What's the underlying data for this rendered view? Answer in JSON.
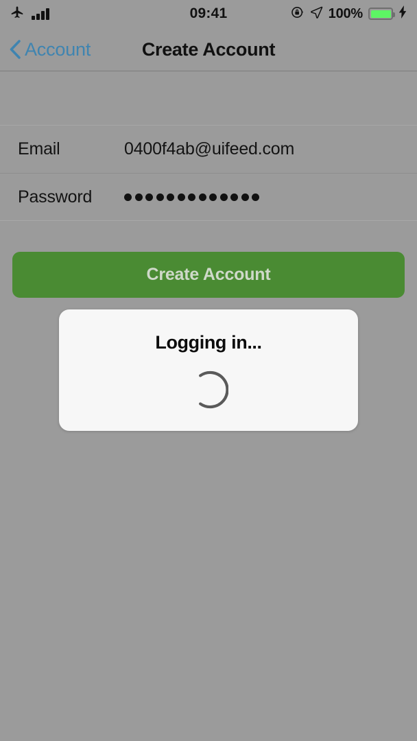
{
  "status_bar": {
    "airplane_icon": "airplane-mode-icon",
    "signal_icon": "signal-bars-icon",
    "time": "09:41",
    "rotation_lock_icon": "rotation-lock-icon",
    "location_icon": "location-arrow-icon",
    "battery_percent": "100%",
    "battery_icon": "battery-icon",
    "charging_icon": "lightning-bolt-icon",
    "battery_color": "#5df564"
  },
  "nav_bar": {
    "back_icon": "chevron-left-icon",
    "back_label": "Account",
    "title": "Create Account",
    "back_color": "#3f84b0"
  },
  "form": {
    "rows": [
      {
        "label": "Email",
        "value": "0400f4ab@uifeed.com",
        "type": "text"
      },
      {
        "label": "Password",
        "value": "•••••••••••••",
        "type": "password",
        "dot_count": 13
      }
    ]
  },
  "primary_button": {
    "label": "Create Account",
    "color": "#4a8b33",
    "label_color": "#cfd9c9",
    "disabled": true
  },
  "modal": {
    "title": "Logging in...",
    "spinner_icon": "loading-spinner-icon",
    "spinner_color": "#5a5a5a",
    "background": "#f7f7f7"
  },
  "theme": {
    "screen_background": "#9b9b9b",
    "separator": "#8e8e8e",
    "text_primary": "#131313"
  }
}
